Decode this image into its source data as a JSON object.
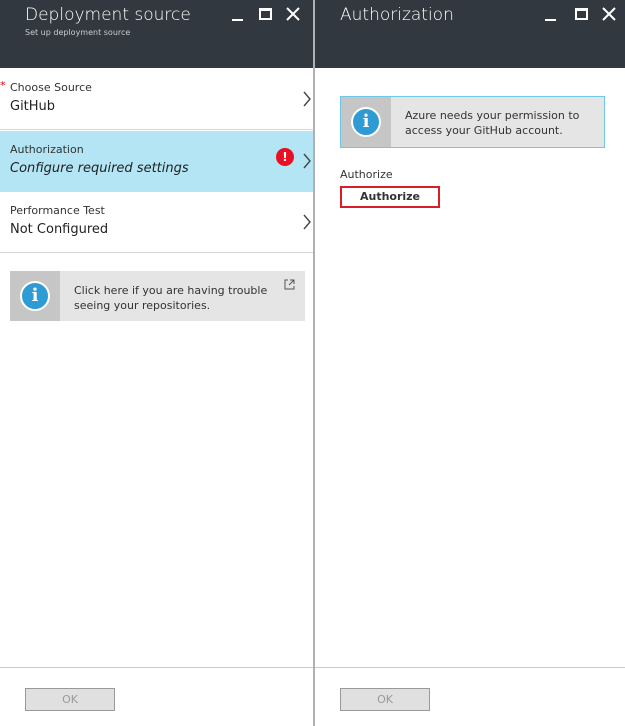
{
  "left_blade": {
    "title": "Deployment source",
    "subtitle": "Set up deployment source",
    "items": [
      {
        "label": "Choose Source",
        "value": "GitHub",
        "required": "*"
      },
      {
        "label": "Authorization",
        "value": "Configure required settings",
        "badge": "!"
      },
      {
        "label": "Performance Test",
        "value": "Not Configured"
      }
    ],
    "info": {
      "line1": "Click here if you are having trouble",
      "line2": "seeing your repositories."
    },
    "ok_label": "OK"
  },
  "right_blade": {
    "title": "Authorization",
    "info": {
      "line1": "Azure needs your permission to",
      "line2": "access your GitHub account."
    },
    "section_label": "Authorize",
    "authorize_button": "Authorize",
    "ok_label": "OK"
  },
  "icons": {
    "info": "info-icon",
    "error": "error-icon",
    "external": "external-link-icon",
    "chevron": "chevron-right-icon"
  },
  "colors": {
    "header_bg": "#32383f",
    "selected_bg": "#b3e5f5",
    "info_blue": "#2f9bd5",
    "error_red": "#e81123",
    "authorize_border": "#d81e28"
  }
}
